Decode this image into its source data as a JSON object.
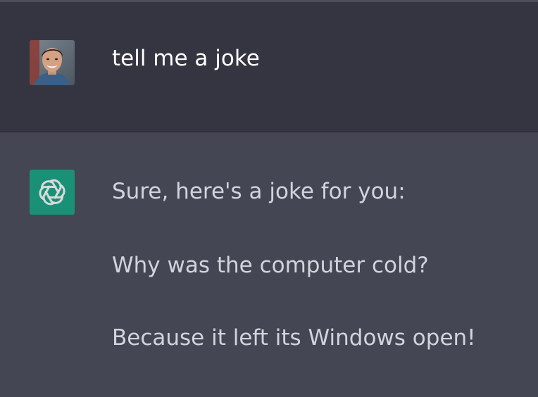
{
  "conversation": {
    "user_message": {
      "avatar": "user-photo",
      "text": "tell me a joke"
    },
    "assistant_message": {
      "icon": "openai-logo-icon",
      "icon_bg": "#10a37f",
      "paragraphs": [
        "Sure, here's a joke for you:",
        "Why was the computer cold?",
        "Because it left its Windows open!"
      ]
    }
  },
  "colors": {
    "user_row_bg": "#343541",
    "assistant_row_bg": "#444654"
  }
}
